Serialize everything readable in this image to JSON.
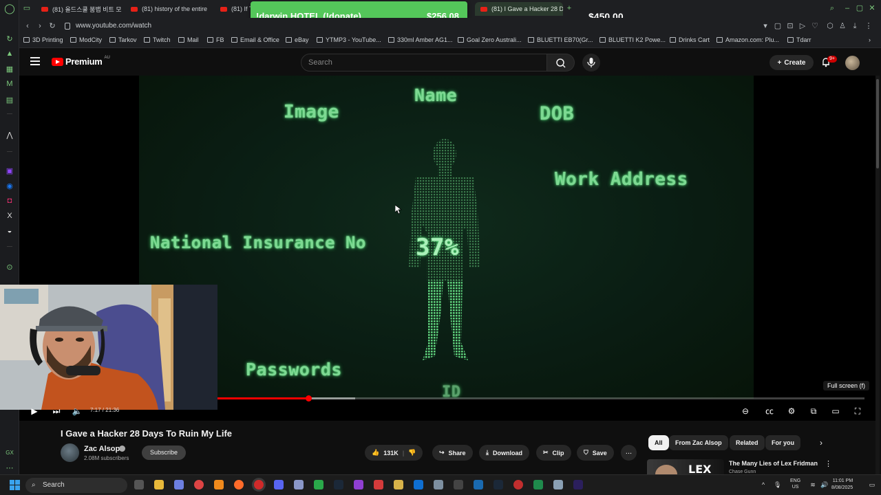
{
  "browser": {
    "tabs": [
      {
        "label": "(81) 올드스쿨 붐뱁 비트 모"
      },
      {
        "label": "(81) history of the entire"
      },
      {
        "label": "(81) If Th"
      },
      {
        "label": "(81) I Gave a Hacker 28 D"
      }
    ],
    "new_tab_icon": "+",
    "url": "www.youtube.com/watch",
    "bookmarks": [
      {
        "label": "3D Printing"
      },
      {
        "label": "ModCity"
      },
      {
        "label": "Tarkov"
      },
      {
        "label": "Twitch"
      },
      {
        "label": "Mail"
      },
      {
        "label": "FB"
      },
      {
        "label": "Email & Office"
      },
      {
        "label": "eBay"
      },
      {
        "label": "YTMP3 - YouTube..."
      },
      {
        "label": "330ml Amber AG1..."
      },
      {
        "label": "Goal Zero Australi..."
      },
      {
        "label": "BLUETTI EB70(Gr..."
      },
      {
        "label": "BLUETTI K2 Powe..."
      },
      {
        "label": "Drinks Cart"
      },
      {
        "label": "Amazon.com: Plu..."
      },
      {
        "label": "Tdarr"
      }
    ]
  },
  "overlay": {
    "donor": "!darwin HOTEL (!donate)",
    "amount": "$256.08",
    "goal_amount": "$450.00"
  },
  "youtube": {
    "brand": "Premium",
    "region": "AU",
    "search_placeholder": "Search",
    "create_label": "Create",
    "notification_count": "9+"
  },
  "video_overlay": {
    "image": "Image",
    "name": "Name",
    "dob": "DOB",
    "work_address": "Work Address",
    "national_insurance": "National Insurance No",
    "percent": "37%",
    "passwords": "Passwords",
    "id": "ID"
  },
  "player": {
    "time": "7:17 / 21:36",
    "fullscreen_tooltip": "Full screen (f)",
    "progress_fraction": 0.337
  },
  "video": {
    "title": "I Gave a Hacker 28 Days To Ruin My Life",
    "channel": "Zac Alsop",
    "subscribers": "2.08M subscribers",
    "subscribe": "Subscribe",
    "likes": "131K",
    "share": "Share",
    "download": "Download",
    "clip": "Clip",
    "save": "Save",
    "more": "..."
  },
  "related": {
    "chips": [
      "All",
      "From Zac Alsop",
      "Related",
      "For you"
    ],
    "first_title": "The Many Lies of Lex Fridman",
    "first_sub": "Chase Gunn"
  },
  "taskbar": {
    "search": "Search",
    "lang": "ENG",
    "region": "US",
    "time": "11:01 PM",
    "date": "8/08/2025"
  },
  "colors": {
    "hud_green": "#7dd992",
    "donate_green": "#54c75a",
    "yt_red": "#ff0000",
    "opera_green": "#7cc97c"
  }
}
